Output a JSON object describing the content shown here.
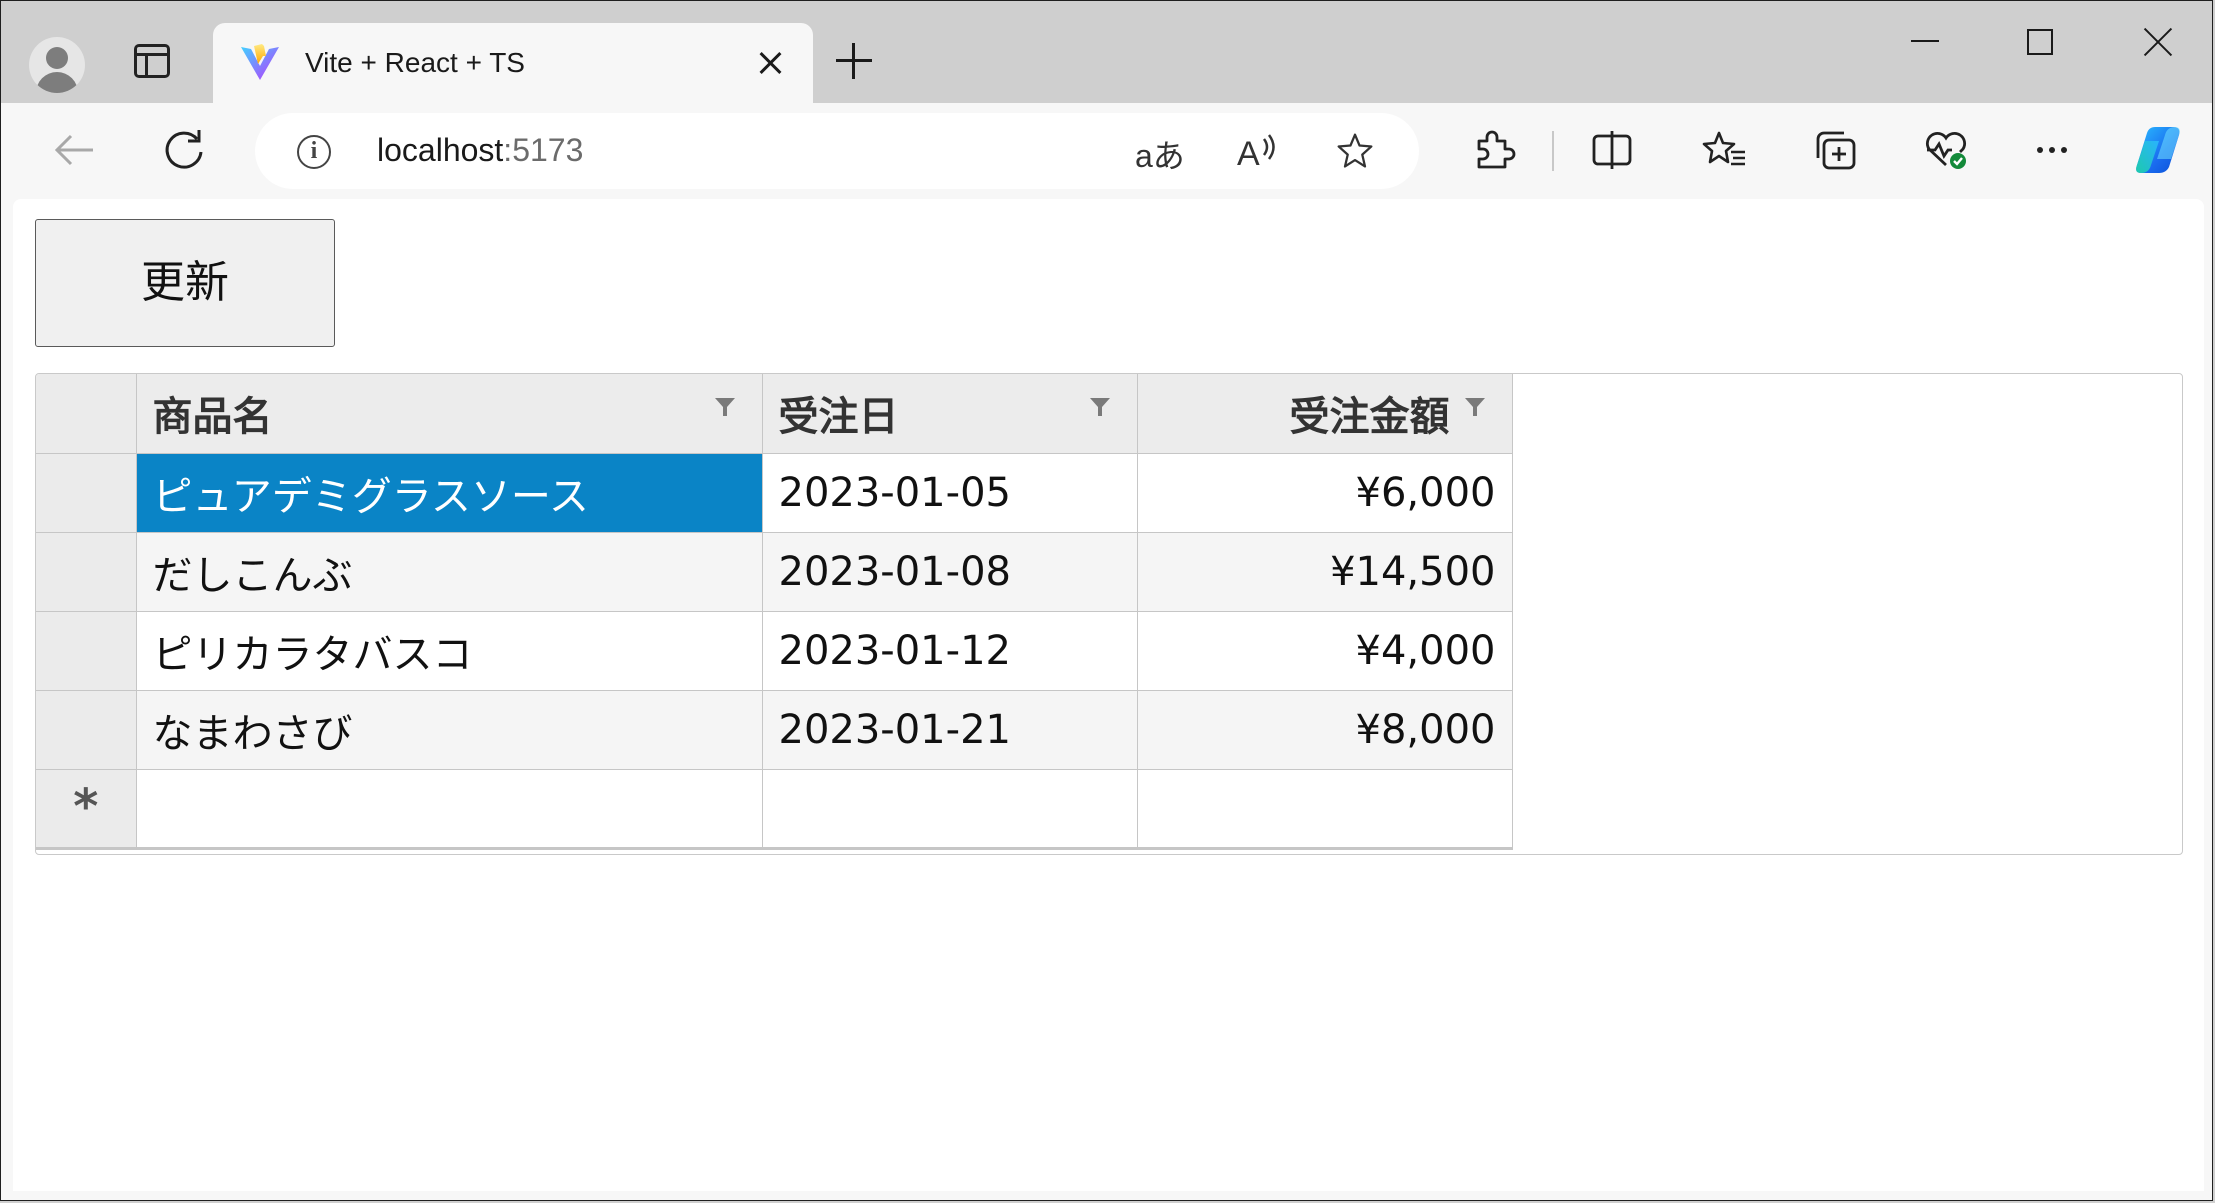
{
  "browser": {
    "tab": {
      "title": "Vite + React + TS"
    },
    "address": {
      "host": "localhost",
      "port": ":5173"
    },
    "address_icons": {
      "translate": "aあ",
      "read_aloud": "A"
    }
  },
  "page": {
    "refresh_label": "更新",
    "grid": {
      "columns": [
        {
          "label": "商品名"
        },
        {
          "label": "受注日"
        },
        {
          "label": "受注金額"
        }
      ],
      "rows": [
        {
          "product": "ピュアデミグラスソース",
          "date": "2023-01-05",
          "amount": "¥6,000"
        },
        {
          "product": "だしこんぶ",
          "date": "2023-01-08",
          "amount": "¥14,500"
        },
        {
          "product": "ピリカラタバスコ",
          "date": "2023-01-12",
          "amount": "¥4,000"
        },
        {
          "product": "なまわさび",
          "date": "2023-01-21",
          "amount": "¥8,000"
        }
      ],
      "new_row_marker": "*"
    }
  },
  "colors": {
    "selection": "#0a84c6",
    "header_bg": "#ececec",
    "alt_row_bg": "#f5f5f5"
  }
}
